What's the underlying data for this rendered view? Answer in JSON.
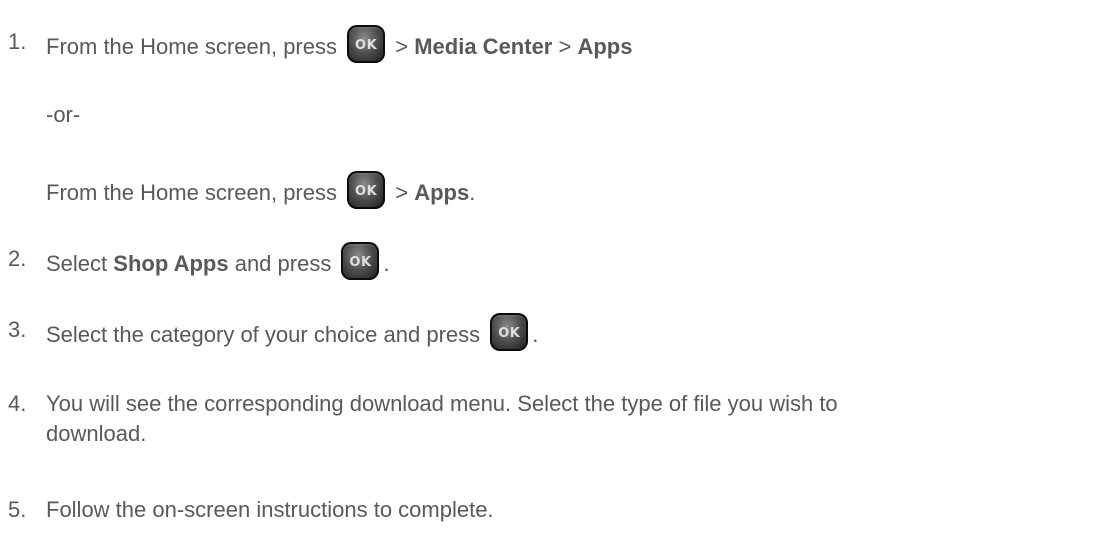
{
  "ok_button_label": "OK",
  "steps": [
    {
      "number": "1.",
      "part_a": "From the Home screen, press",
      "sep1": ">",
      "media_center": "Media Center",
      "sep2": ">",
      "apps": "Apps",
      "or_text": "-or-",
      "alt_part_a": "From the Home screen, press",
      "alt_sep": ">",
      "alt_apps": "Apps",
      "alt_end": "."
    },
    {
      "number": "2.",
      "part_a": "Select",
      "bold": "Shop Apps",
      "part_b": "and press",
      "end": "."
    },
    {
      "number": "3.",
      "part_a": "Select the category of your choice and press",
      "end": "."
    },
    {
      "number": "4.",
      "line1": "You will see the corresponding download menu. Select the type of file you wish to",
      "line2": "download."
    },
    {
      "number": "5.",
      "text": "Follow the on-screen instructions to complete."
    }
  ]
}
